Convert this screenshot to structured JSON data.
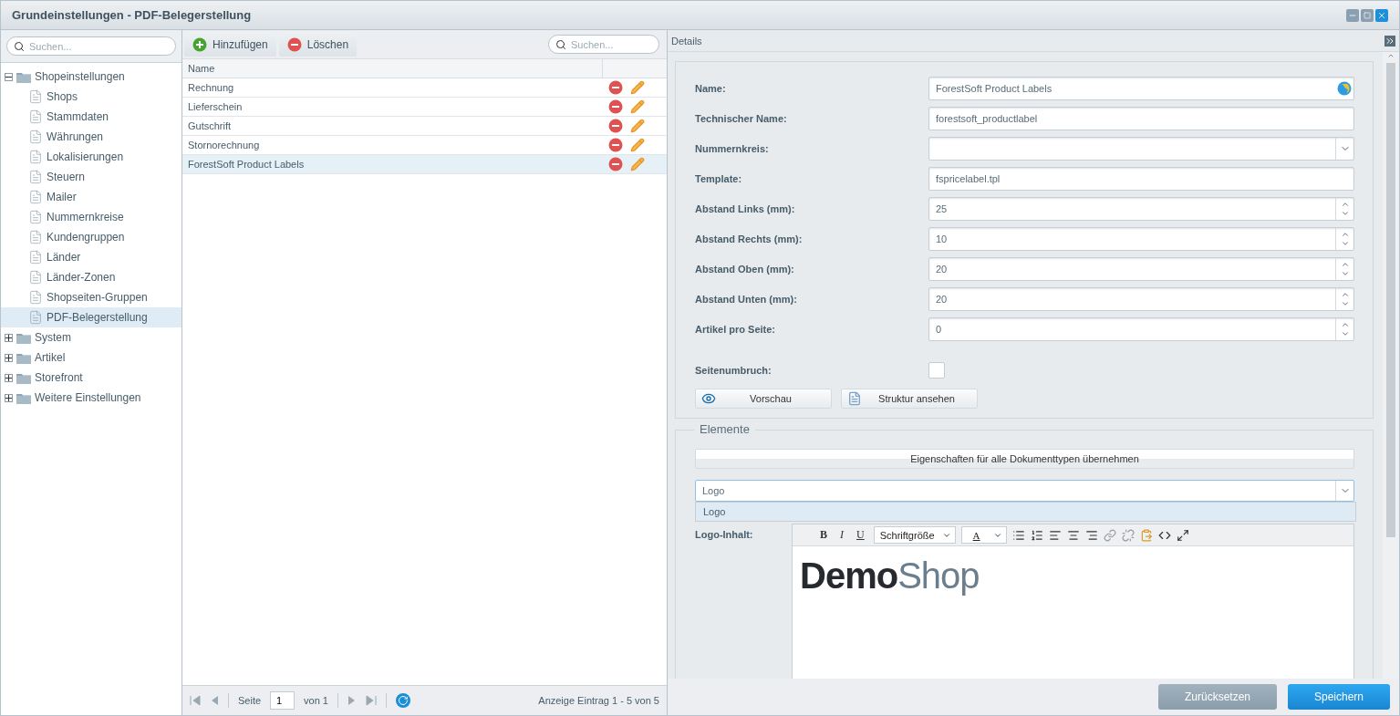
{
  "window": {
    "title": "Grundeinstellungen - PDF-Belegerstellung"
  },
  "tree": {
    "search": {
      "placeholder": "Suchen..."
    },
    "items": [
      {
        "label": "Shopeinstellungen",
        "expanded": true,
        "selected": false,
        "children": [
          {
            "label": "Shops",
            "selected": false
          },
          {
            "label": "Stammdaten",
            "selected": false
          },
          {
            "label": "Währungen",
            "selected": false
          },
          {
            "label": "Lokalisierungen",
            "selected": false
          },
          {
            "label": "Steuern",
            "selected": false
          },
          {
            "label": "Mailer",
            "selected": false
          },
          {
            "label": "Nummernkreise",
            "selected": false
          },
          {
            "label": "Kundengruppen",
            "selected": false
          },
          {
            "label": "Länder",
            "selected": false
          },
          {
            "label": "Länder-Zonen",
            "selected": false
          },
          {
            "label": "Shopseiten-Gruppen",
            "selected": false
          },
          {
            "label": "PDF-Belegerstellung",
            "selected": true
          }
        ]
      },
      {
        "label": "System",
        "expanded": false,
        "selected": false
      },
      {
        "label": "Artikel",
        "expanded": false,
        "selected": false
      },
      {
        "label": "Storefront",
        "expanded": false,
        "selected": false
      },
      {
        "label": "Weitere Einstellungen",
        "expanded": false,
        "selected": false
      }
    ]
  },
  "grid": {
    "toolbar": [
      {
        "kind": "add",
        "label": "Hinzufügen"
      },
      {
        "kind": "delete",
        "label": "Löschen"
      }
    ],
    "search": {
      "placeholder": "Suchen..."
    },
    "columns": [
      "Name"
    ],
    "rows": [
      {
        "name": "Rechnung",
        "selected": false
      },
      {
        "name": "Lieferschein",
        "selected": false
      },
      {
        "name": "Gutschrift",
        "selected": false
      },
      {
        "name": "Stornorechnung",
        "selected": false
      },
      {
        "name": "ForestSoft Product Labels",
        "selected": true
      }
    ],
    "pager": {
      "page_label": "Seite",
      "page": "1",
      "of": "von 1",
      "summary": "Anzeige Eintrag 1 - 5 von 5"
    }
  },
  "details": {
    "title": "Details",
    "fields": [
      {
        "kind": "text",
        "label": "Name:",
        "value": "ForestSoft Product Labels",
        "translatable": true
      },
      {
        "kind": "text",
        "label": "Technischer Name:",
        "value": "forestsoft_productlabel"
      },
      {
        "kind": "combo",
        "label": "Nummernkreis:"
      },
      {
        "kind": "text",
        "label": "Template:",
        "value": "fspricelabel.tpl"
      },
      {
        "kind": "number",
        "label": "Abstand Links (mm):",
        "value": "25"
      },
      {
        "kind": "number",
        "label": "Abstand Rechts (mm):",
        "value": "10"
      },
      {
        "kind": "number",
        "label": "Abstand Oben (mm):",
        "value": "20"
      },
      {
        "kind": "number",
        "label": "Abstand Unten (mm):",
        "value": "20"
      },
      {
        "kind": "number",
        "label": "Artikel pro Seite:",
        "value": "0"
      },
      {
        "kind": "checkbox",
        "label": "Seitenumbruch:",
        "checked": false
      }
    ],
    "buttons": [
      {
        "kind": "preview",
        "label": "Vorschau"
      },
      {
        "kind": "structure",
        "label": "Struktur ansehen"
      }
    ],
    "elements": {
      "legend": "Elemente",
      "apply_button": "Eigenschaften für alle Dokumenttypen übernehmen",
      "select": {
        "value": "Logo",
        "options": [
          {
            "label": "Logo",
            "selected": true
          }
        ]
      },
      "editor": {
        "label": "Logo-Inhalt:",
        "format_buttons": [
          "B",
          "I",
          "U"
        ],
        "font_size": "Schriftgröße",
        "color_button": "A",
        "logo": {
          "bold": "Demo",
          "light": "Shop"
        }
      }
    },
    "footer": [
      {
        "kind": "secondary",
        "label": "Zurücksetzen"
      },
      {
        "kind": "primary",
        "label": "Speichern"
      }
    ]
  }
}
